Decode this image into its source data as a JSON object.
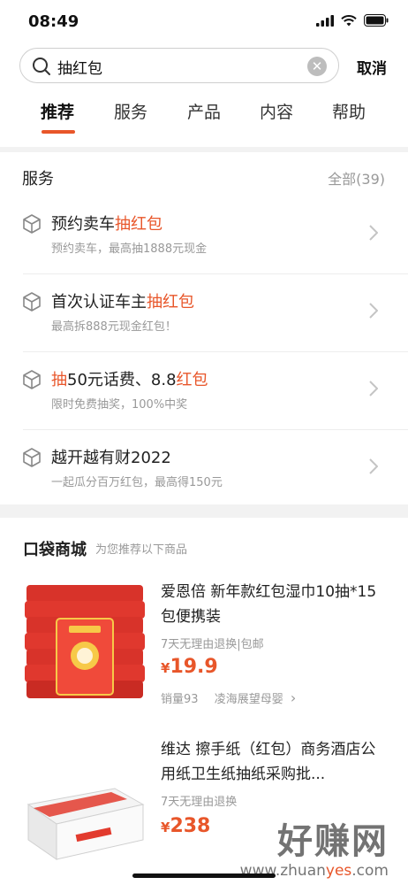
{
  "status": {
    "time": "08:49"
  },
  "search": {
    "query": "抽红包",
    "cancel": "取消"
  },
  "tabs": [
    "推荐",
    "服务",
    "产品",
    "内容",
    "帮助"
  ],
  "services": {
    "title": "服务",
    "all": "全部(39)",
    "items": [
      {
        "pre": "预约卖车",
        "hl": "抽红包",
        "post": "",
        "sub": "预约卖车，最高抽1888元现金"
      },
      {
        "pre": "首次认证车主",
        "hl": "抽红包",
        "post": "",
        "sub": "最高拆888元现金红包！"
      },
      {
        "pre": "",
        "hl": "抽",
        "post": "50元话费、8.8",
        "hl2": "红包",
        "sub": "限时免费抽奖，100%中奖"
      },
      {
        "pre": "越开越有财2022",
        "hl": "",
        "post": "",
        "sub": "一起瓜分百万红包，最高得150元"
      }
    ]
  },
  "shop": {
    "title": "口袋商城",
    "subtitle": "为您推荐以下商品",
    "products": [
      {
        "name": "爱恩倍 新年款红包湿巾10抽*15包便携装",
        "meta": "7天无理由退换|包邮",
        "currency": "¥",
        "price": "19.9",
        "sales": "销量93",
        "store": "凌海展望母婴"
      },
      {
        "name": "维达 擦手纸（红包）商务酒店公用纸卫生纸抽纸采购批...",
        "meta": "7天无理由退换",
        "currency": "¥",
        "price": "238"
      }
    ]
  },
  "watermark": {
    "cn": "好赚网",
    "url_a": "www.zhuan",
    "url_b": "yes",
    "url_c": ".com"
  },
  "colors": {
    "accent": "#e8562a"
  }
}
